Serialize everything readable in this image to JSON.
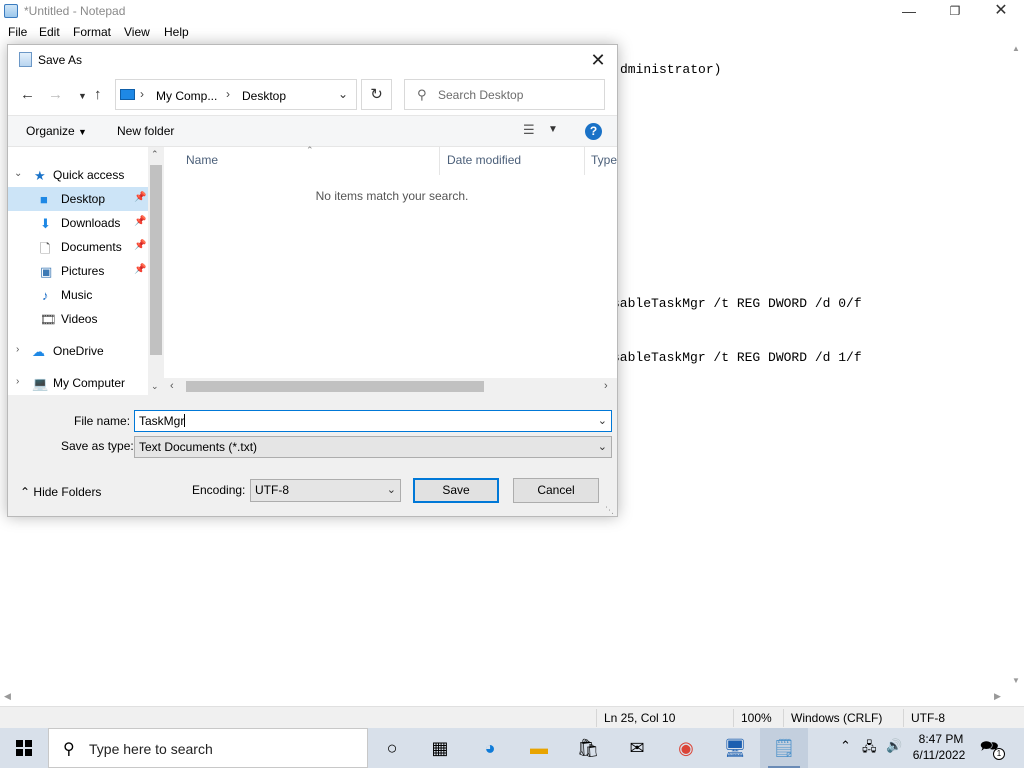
{
  "notepad": {
    "title": "*Untitled - Notepad",
    "menu": [
      "File",
      "Edit",
      "Format",
      "View",
      "Help"
    ],
    "visible_text_fragments": [
      "dministrator)",
      "sableTaskMgr /t REG DWORD /d 0/f",
      "sableTaskMgr /t REG DWORD /d 1/f"
    ],
    "status": {
      "position": "Ln 25, Col 10",
      "zoom": "100%",
      "line_ending": "Windows (CRLF)",
      "encoding": "UTF-8"
    }
  },
  "dialog": {
    "title": "Save As",
    "close_glyph": "✕",
    "address": {
      "root": "My Comp...",
      "current": "Desktop"
    },
    "search": {
      "placeholder": "Search Desktop"
    },
    "toolbar": {
      "organize": "Organize",
      "new_folder": "New folder",
      "help": "?"
    },
    "nav": {
      "quick_access": "Quick access",
      "items": [
        {
          "label": "Desktop",
          "pinned": true,
          "selected": true
        },
        {
          "label": "Downloads",
          "pinned": true
        },
        {
          "label": "Documents",
          "pinned": true
        },
        {
          "label": "Pictures",
          "pinned": true
        },
        {
          "label": "Music"
        },
        {
          "label": "Videos"
        }
      ],
      "onedrive": "OneDrive",
      "my_computer": "My Computer"
    },
    "columns": {
      "name": "Name",
      "date_modified": "Date modified",
      "type": "Type"
    },
    "empty_message": "No items match your search.",
    "form": {
      "file_name_label": "File name:",
      "file_name_value": "TaskMgr",
      "save_type_label": "Save as type:",
      "save_type_value": "Text Documents (*.txt)",
      "encoding_label": "Encoding:",
      "encoding_value": "UTF-8",
      "hide_folders": "Hide Folders",
      "save": "Save",
      "cancel": "Cancel"
    }
  },
  "taskbar": {
    "search_placeholder": "Type here to search",
    "clock_time": "8:47 PM",
    "clock_date": "6/11/2022",
    "notification_count": "1"
  },
  "colors": {
    "accent": "#0078d7",
    "selection": "#cce4f7",
    "taskbar": "#d8e0ea"
  }
}
